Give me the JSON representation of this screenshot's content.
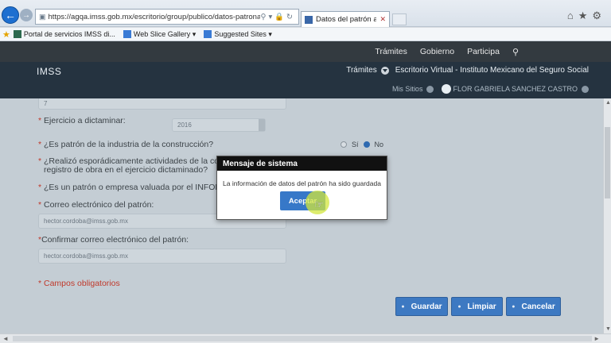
{
  "browser": {
    "url": "https://agqa.imss.gob.mx/escritorio/group/publico/datos-patronales",
    "tab_title": "Datos del patrón a dictamin...",
    "favorites": [
      {
        "label": "Portal de servicios IMSS di..."
      },
      {
        "label": "Web Slice Gallery ▾"
      },
      {
        "label": "Suggested Sites ▾"
      }
    ]
  },
  "topnav": {
    "items": [
      "Trámites",
      "Gobierno",
      "Participa"
    ]
  },
  "header": {
    "brand": "IMSS",
    "tramites": "Trámites",
    "portal_title": "Escritorio Virtual - Instituto Mexicano del Seguro Social",
    "mis_sitios": "Mis Sitios",
    "user_name": "FLOR GABRIELA SANCHEZ CASTRO"
  },
  "form": {
    "top_field_value": "7",
    "ejercicio_label": "Ejercicio a dictaminar:",
    "ejercicio_value": "2016",
    "construccion_label": "¿Es patrón de la industria de la construcción?",
    "radio_si": "Sí",
    "radio_no": "No",
    "esporadico_label_1": "¿Realizó esporádicamente actividades de la construc",
    "esporadico_label_2": "registro de obra en el ejercicio dictaminado?",
    "infonavit_label": "¿Es un patrón o empresa valuada por el INFONAVIT",
    "correo_label": "Correo electrónico del patrón:",
    "correo_value": "hector.cordoba@imss.gob.mx",
    "confirmar_label": "Confirmar correo electrónico del patrón:",
    "confirmar_value": "hector.cordoba@imss.gob.mx",
    "required_mark": "*",
    "mandatory_note": "* Campos obligatorios"
  },
  "buttons": {
    "guardar": "Guardar",
    "limpiar": "Limpiar",
    "cancelar": "Cancelar"
  },
  "modal": {
    "title": "Mensaje de sistema",
    "message": "La información de datos del patrón ha sido guardada",
    "ok": "Aceptar"
  },
  "colors": {
    "header_dark": "#253340",
    "topnav": "#333a40",
    "button_blue": "#3d79c2",
    "required_red": "#c0392b"
  }
}
